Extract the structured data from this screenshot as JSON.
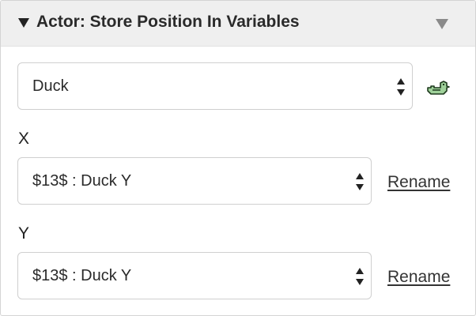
{
  "header": {
    "title": "Actor: Store Position In Variables",
    "collapse_icon": "triangle-down-icon",
    "menu_icon": "triangle-down-icon"
  },
  "actor_select": {
    "value": "Duck",
    "icon": "duck-sprite-icon"
  },
  "x_field": {
    "label": "X",
    "value": "$13$ : Duck Y",
    "rename_label": "Rename"
  },
  "y_field": {
    "label": "Y",
    "value": "$13$ : Duck Y",
    "rename_label": "Rename"
  },
  "colors": {
    "header_bg": "#efefef",
    "border": "#cfcfcf",
    "text": "#222222",
    "duck_green": "#4c8a4a"
  }
}
